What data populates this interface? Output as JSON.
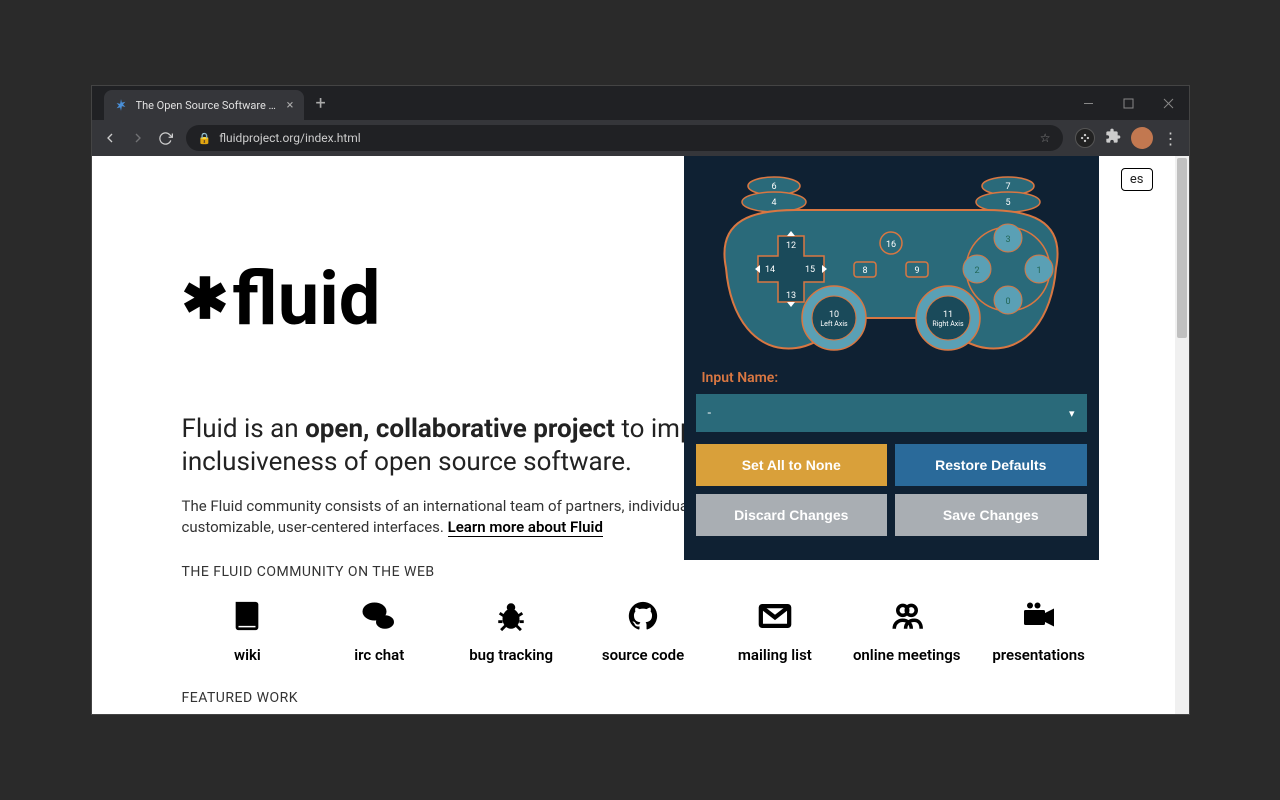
{
  "browser": {
    "tab_title": "The Open Source Software Comm",
    "url": "fluidproject.org/index.html",
    "peek_button": "es"
  },
  "page": {
    "logo": "fluid",
    "headline_prefix": "Fluid is an ",
    "headline_bold": "open, collaborative project",
    "headline_suffix": " to improve",
    "headline_line2": "inclusiveness of open source software.",
    "para_text": "The Fluid community consists of an international team of partners, individuals, ",
    "para_line2": "customizable, user-centered interfaces. ",
    "learn_more": "Learn more about Fluid",
    "community_title": "THE FLUID COMMUNITY ON THE WEB",
    "community": [
      {
        "label": "wiki"
      },
      {
        "label": "irc chat"
      },
      {
        "label": "bug tracking"
      },
      {
        "label": "source code"
      },
      {
        "label": "mailing list"
      },
      {
        "label": "online meetings"
      },
      {
        "label": "presentations"
      }
    ],
    "featured_title": "FEATURED WORK"
  },
  "popup": {
    "input_name_label": "Input Name:",
    "select_value": "-",
    "set_all_none": "Set All to None",
    "restore_defaults": "Restore Defaults",
    "discard": "Discard Changes",
    "save": "Save Changes",
    "buttons": {
      "b6": "6",
      "b7": "7",
      "b4": "4",
      "b5": "5",
      "b12": "12",
      "b13": "13",
      "b14": "14",
      "b15": "15",
      "b16": "16",
      "b8": "8",
      "b9": "9",
      "b0": "0",
      "b1": "1",
      "b2": "2",
      "b3": "3",
      "a10": "10",
      "a10l": "Left Axis",
      "a11": "11",
      "a11l": "Right Axis"
    }
  }
}
